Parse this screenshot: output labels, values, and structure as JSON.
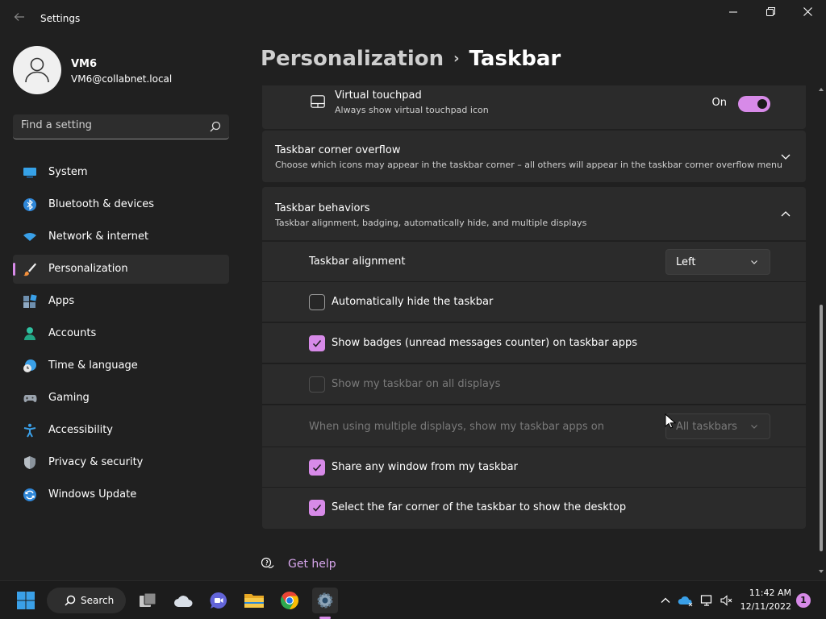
{
  "window": {
    "title": "Settings",
    "back_icon": "arrow-left-icon",
    "minimize_icon": "minimize-icon",
    "restore_icon": "restore-icon",
    "close_icon": "close-icon"
  },
  "profile": {
    "name": "VM6",
    "email": "VM6@collabnet.local"
  },
  "search": {
    "placeholder": "Find a setting"
  },
  "sidebar": {
    "items": [
      {
        "label": "System",
        "icon": "system-icon",
        "active": false
      },
      {
        "label": "Bluetooth & devices",
        "icon": "bluetooth-icon",
        "active": false
      },
      {
        "label": "Network & internet",
        "icon": "wifi-icon",
        "active": false
      },
      {
        "label": "Personalization",
        "icon": "brush-icon",
        "active": true
      },
      {
        "label": "Apps",
        "icon": "apps-icon",
        "active": false
      },
      {
        "label": "Accounts",
        "icon": "person-icon",
        "active": false
      },
      {
        "label": "Time & language",
        "icon": "clock-globe-icon",
        "active": false
      },
      {
        "label": "Gaming",
        "icon": "controller-icon",
        "active": false
      },
      {
        "label": "Accessibility",
        "icon": "accessibility-icon",
        "active": false
      },
      {
        "label": "Privacy & security",
        "icon": "shield-icon",
        "active": false
      },
      {
        "label": "Windows Update",
        "icon": "update-icon",
        "active": false
      }
    ]
  },
  "breadcrumb": {
    "parent": "Personalization",
    "separator": "›",
    "current": "Taskbar"
  },
  "cards": {
    "virtual_touchpad": {
      "title": "Virtual touchpad",
      "subtitle": "Always show virtual touchpad icon",
      "toggle_label": "On",
      "toggle_on": true
    },
    "corner_overflow": {
      "title": "Taskbar corner overflow",
      "subtitle": "Choose which icons may appear in the taskbar corner – all others will appear in the taskbar corner overflow menu",
      "expanded": false
    },
    "behaviors": {
      "title": "Taskbar behaviors",
      "subtitle": "Taskbar alignment, badging, automatically hide, and multiple displays",
      "expanded": true,
      "alignment": {
        "label": "Taskbar alignment",
        "value": "Left"
      },
      "auto_hide": {
        "label": "Automatically hide the taskbar",
        "checked": false
      },
      "badges": {
        "label": "Show badges (unread messages counter) on taskbar apps",
        "checked": true
      },
      "all_displays": {
        "label": "Show my taskbar on all displays",
        "checked": false,
        "disabled": true
      },
      "multi_display": {
        "label": "When using multiple displays, show my taskbar apps on",
        "value": "All taskbars",
        "disabled": true
      },
      "share_window": {
        "label": "Share any window from my taskbar",
        "checked": true
      },
      "far_corner": {
        "label": "Select the far corner of the taskbar to show the desktop",
        "checked": true
      }
    }
  },
  "help": {
    "label": "Get help"
  },
  "taskbar": {
    "search_label": "Search",
    "time": "11:42 AM",
    "date": "12/11/2022",
    "notification_count": "1",
    "apps": [
      "start-icon",
      "search-icon",
      "task-view-icon",
      "widgets-icon",
      "teams-chat-icon",
      "file-explorer-icon",
      "chrome-icon",
      "settings-icon"
    ],
    "accent_color": "#d78ae8"
  }
}
